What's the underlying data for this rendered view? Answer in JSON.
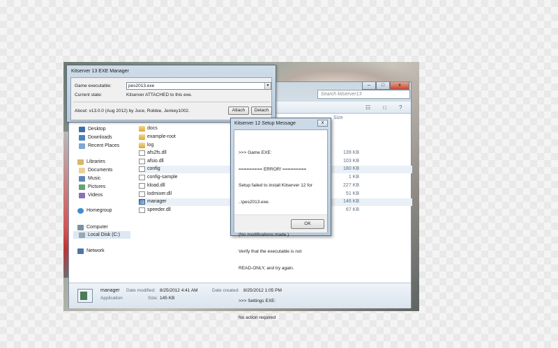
{
  "exe_manager": {
    "title": "Kitserver 13 EXE Manager",
    "game_executable_label": "Game executable:",
    "game_executable_value": "pes2013.exe",
    "current_state_label": "Current state:",
    "current_state_value": "Kitserver ATTACHED to this exe.",
    "about": "About: v13.0.0 (Aug 2012) by Juce, Robbie, Jenkey1002.",
    "attach_label": "Attach",
    "detach_label": "Detach"
  },
  "setup_message": {
    "title": "Kitserver 12 Setup Message",
    "close_glyph": "x",
    "lines": [
      ">>> Game EXE:",
      "========= ERROR! =========",
      "Setup failed to install Kitserver 12 for",
      "..\\pes2013.exe.",
      "",
      "(No modifications made.)",
      "Verify that the executable is not",
      "READ-ONLY, and try again.",
      "",
      ">>> Settings EXE:",
      "No action required"
    ],
    "ok_label": "OK"
  },
  "explorer": {
    "search_placeholder": "Search kitserver13",
    "column_size_header": "Size",
    "nav": {
      "favorites": [
        {
          "label": "Desktop",
          "icon": "desktop-icon"
        },
        {
          "label": "Downloads",
          "icon": "downloads-icon"
        },
        {
          "label": "Recent Places",
          "icon": "recent-places-icon"
        }
      ],
      "libraries_label": "Libraries",
      "libraries": [
        {
          "label": "Documents",
          "icon": "documents-icon"
        },
        {
          "label": "Music",
          "icon": "music-icon"
        },
        {
          "label": "Pictures",
          "icon": "pictures-icon"
        },
        {
          "label": "Videos",
          "icon": "videos-icon"
        }
      ],
      "homegroup_label": "Homegroup",
      "computer_label": "Computer",
      "local_disk_label": "Local Disk (C:)",
      "network_label": "Network"
    },
    "files": [
      {
        "name": "docs",
        "type": "folder",
        "size": ""
      },
      {
        "name": "example-root",
        "type": "folder",
        "size": ""
      },
      {
        "name": "log",
        "type": "folder",
        "size": ""
      },
      {
        "name": "afs2fs.dll",
        "type": "dll",
        "size": "139 KB"
      },
      {
        "name": "afsio.dll",
        "type": "dll",
        "size": "103 KB"
      },
      {
        "name": "config",
        "type": "file",
        "size": "180 KB"
      },
      {
        "name": "config-sample",
        "type": "file",
        "size": "1 KB"
      },
      {
        "name": "kload.dll",
        "type": "dll",
        "size": "227 KB"
      },
      {
        "name": "lodmixer.dll",
        "type": "dll",
        "size": "51 KB"
      },
      {
        "name": "manager",
        "type": "app",
        "size": "146 KB"
      },
      {
        "name": "speeder.dll",
        "type": "dll",
        "size": "67 KB"
      }
    ],
    "details": {
      "name": "manager",
      "type": "Application",
      "date_modified_label": "Date modified:",
      "date_modified": "8/25/2012 4:41 AM",
      "size_label": "Size:",
      "size": "145 KB",
      "date_created_label": "Date created:",
      "date_created": "8/25/2012 1:05 PM"
    }
  },
  "colors": {
    "title_bar": "#cfdde9",
    "selection": "#dde8f3",
    "folder": "#d9a944"
  }
}
